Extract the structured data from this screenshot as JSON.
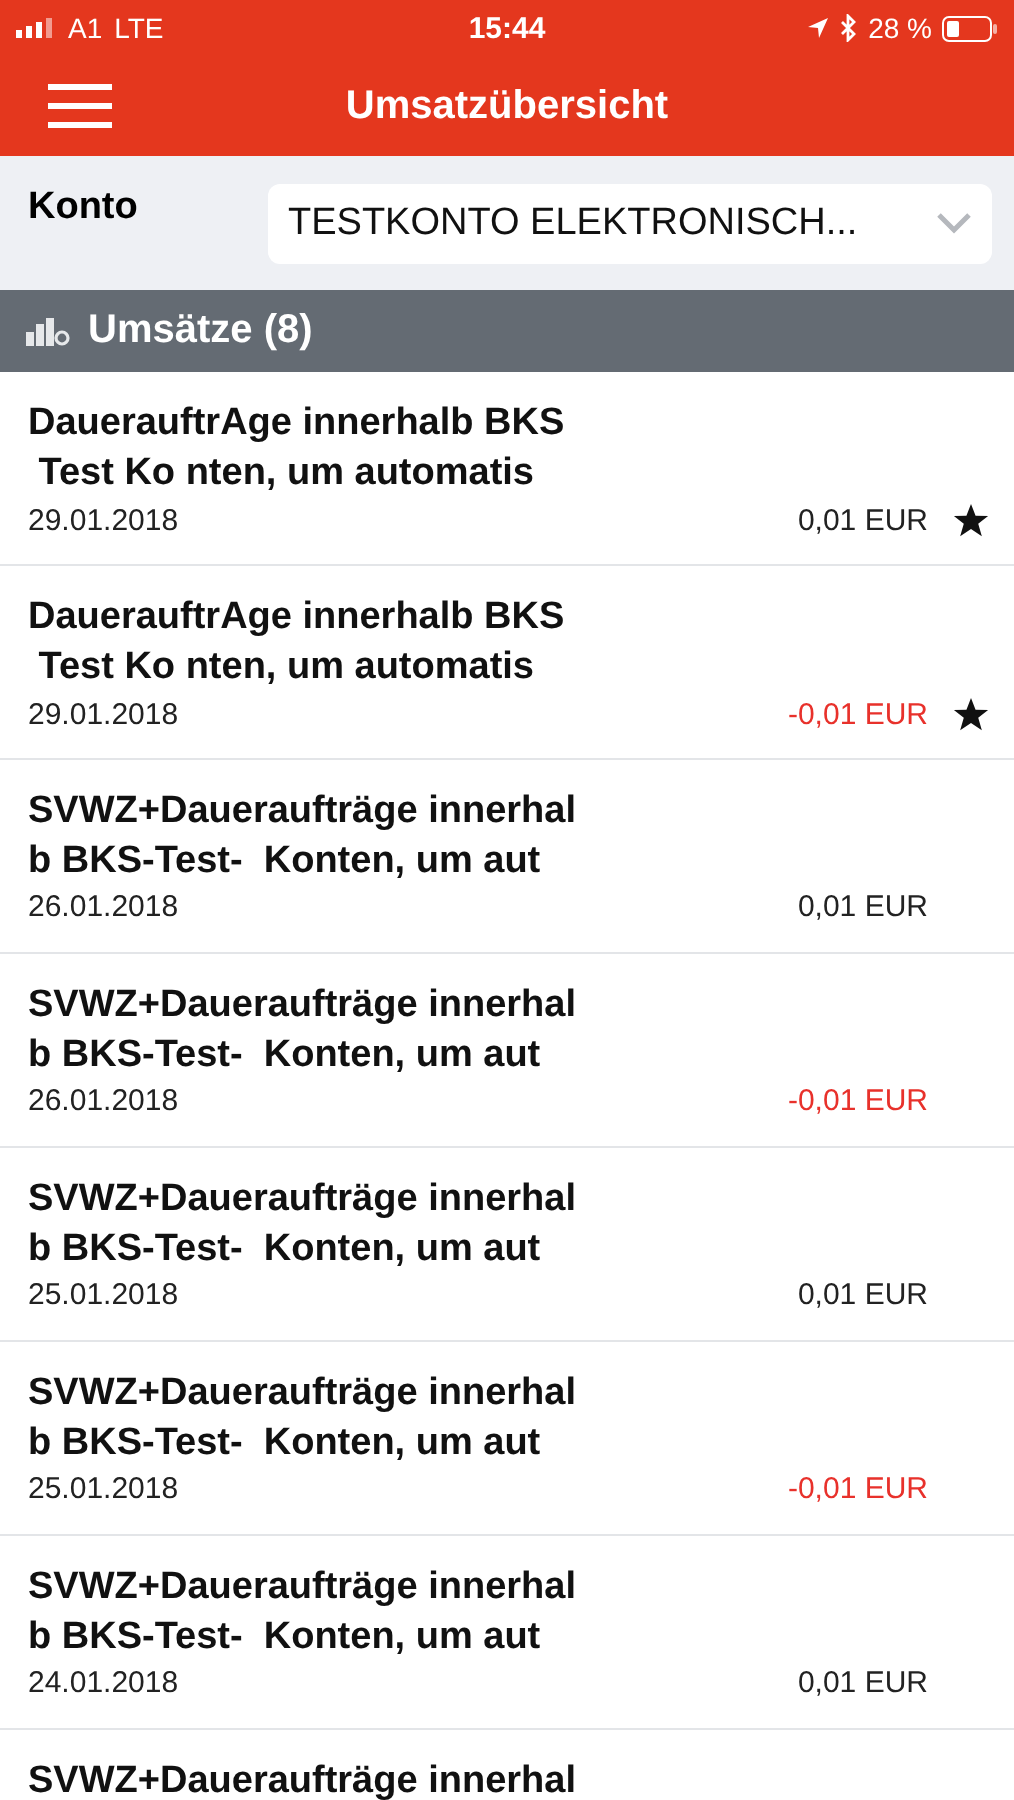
{
  "status_bar": {
    "carrier": "A1",
    "network": "LTE",
    "time": "15:44",
    "battery": "28 %"
  },
  "header": {
    "title": "Umsatzübersicht"
  },
  "account": {
    "label": "Konto",
    "value": "TESTKONTO ELEKTRONISCH..."
  },
  "section": {
    "title": "Umsätze (8)"
  },
  "transactions": [
    {
      "title_lines": [
        "DauerauftrAge innerhalb BKS",
        " Test Ko nten, um automatis"
      ],
      "date": "29.01.2018",
      "amount": "0,01 EUR",
      "kind": "credit",
      "starred": true
    },
    {
      "title_lines": [
        "DauerauftrAge innerhalb BKS",
        " Test Ko nten, um automatis"
      ],
      "date": "29.01.2018",
      "amount": "-0,01 EUR",
      "kind": "debit",
      "starred": true
    },
    {
      "title_lines": [
        "SVWZ+Daueraufträge innerhal",
        "b BKS-Test-  Konten, um aut"
      ],
      "date": "26.01.2018",
      "amount": "0,01 EUR",
      "kind": "credit",
      "starred": false
    },
    {
      "title_lines": [
        "SVWZ+Daueraufträge innerhal",
        "b BKS-Test-  Konten, um aut"
      ],
      "date": "26.01.2018",
      "amount": "-0,01 EUR",
      "kind": "debit",
      "starred": false
    },
    {
      "title_lines": [
        "SVWZ+Daueraufträge innerhal",
        "b BKS-Test-  Konten, um aut"
      ],
      "date": "25.01.2018",
      "amount": "0,01 EUR",
      "kind": "credit",
      "starred": false
    },
    {
      "title_lines": [
        "SVWZ+Daueraufträge innerhal",
        "b BKS-Test-  Konten, um aut"
      ],
      "date": "25.01.2018",
      "amount": "-0,01 EUR",
      "kind": "debit",
      "starred": false
    },
    {
      "title_lines": [
        "SVWZ+Daueraufträge innerhal",
        "b BKS-Test-  Konten, um aut"
      ],
      "date": "24.01.2018",
      "amount": "0,01 EUR",
      "kind": "credit",
      "starred": false
    },
    {
      "title_lines": [
        "SVWZ+Daueraufträge innerhal"
      ]
    }
  ]
}
